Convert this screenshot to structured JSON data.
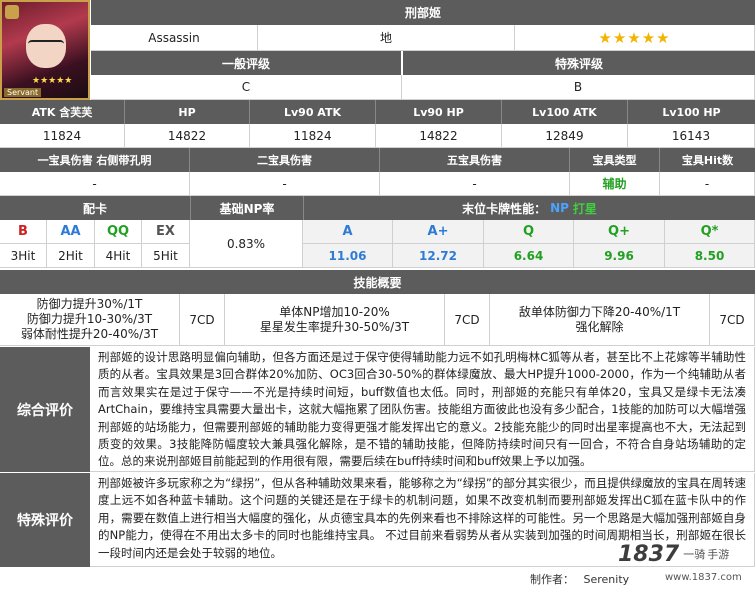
{
  "portrait": {
    "badge": "Servant",
    "rarity_stars": "★★★★★"
  },
  "title": "刑部姬",
  "class_name": "Assassin",
  "attribute": "地",
  "rarity": "★★★★★",
  "rating": {
    "general_label": "一般评级",
    "general_value": "C",
    "special_label": "特殊评级",
    "special_value": "B"
  },
  "stats_headers": [
    "ATK 含芙芙",
    "HP",
    "Lv90 ATK",
    "Lv90 HP",
    "Lv100 ATK",
    "Lv100 HP"
  ],
  "stats_values": [
    "11824",
    "14822",
    "11824",
    "14822",
    "12849",
    "16143"
  ],
  "np_headers": [
    "一宝具伤害 右侧带孔明",
    "二宝具伤害",
    "五宝具伤害",
    "宝具类型",
    "宝具Hit数"
  ],
  "np_values": [
    "-",
    "-",
    "-",
    "辅助",
    "-"
  ],
  "deck": {
    "label": "配卡",
    "cards": [
      {
        "card": "B",
        "hits": "3Hit"
      },
      {
        "card": "AA",
        "hits": "2Hit"
      },
      {
        "card": "QQ",
        "hits": "4Hit"
      },
      {
        "card": "EX",
        "hits": "5Hit"
      }
    ],
    "np_rate_label": "基础NP率",
    "np_rate_value": "0.83%",
    "final_label": "末位卡牌性能：",
    "final_np": "NP",
    "final_star": "打星",
    "final_cards": [
      {
        "card": "A",
        "value": "11.06"
      },
      {
        "card": "A+",
        "value": "12.72"
      },
      {
        "card": "Q",
        "value": "6.64"
      },
      {
        "card": "Q+",
        "value": "9.96"
      },
      {
        "card": "Q*",
        "value": "8.50"
      }
    ]
  },
  "skills": {
    "header": "技能概要",
    "items": [
      {
        "lines": [
          "防御力提升30%/1T",
          "防御力提升10-30%/3T",
          "弱体耐性提升20-40%/3T"
        ],
        "cd": "7CD"
      },
      {
        "lines": [
          "单体NP增加10-20%",
          "星星发生率提升30-50%/3T"
        ],
        "cd": "7CD"
      },
      {
        "lines": [
          "敌单体防御力下降20-40%/1T",
          "强化解除"
        ],
        "cd": "7CD"
      }
    ]
  },
  "overall": {
    "label": "综合评价",
    "text": "刑部姬的设计思路明显偏向辅助，但各方面还是过于保守使得辅助能力远不如孔明梅林C狐等从者，甚至比不上花嫁等半辅助性质的从者。宝具效果是3回合群体20%加防、OC3回合30-50%的群体绿魔放、最大HP提升1000-2000，作为一个纯辅助从者而言效果实在是过于保守——不光是持续时间短，buff数值也太低。同时，刑部姬的充能只有单体20，宝具又是绿卡无法凑ArtChain，要维持宝具需要大量出卡，这就大幅拖累了团队伤害。技能组方面彼此也没有多少配合，1技能的加防可以大幅增强刑部姬的站场能力，但需要刑部姬的辅助能力变得更强才能发挥出它的意义。2技能充能少的同时出星率提高也不大，无法起到质变的效果。3技能降防幅度较大兼具强化解除，是不错的辅助技能，但降防持续时间只有一回合，不符合自身站场辅助的定位。总的来说刑部姬目前能起到的作用很有限，需要后续在buff持续时间和buff效果上予以加强。"
  },
  "special": {
    "label": "特殊评价",
    "text": "刑部姬被许多玩家称之为“绿拐”，但从各种辅助效果来看，能够称之为“绿拐”的部分其实很少，而且提供绿魔放的宝具在周转速度上远不如各种蓝卡辅助。这个问题的关键还是在于绿卡的机制问题，如果不改变机制而要刑部姬发挥出C狐在蓝卡队中的作用，需要在数值上进行相当大幅度的强化，从贞德宝具本的先例来看也不排除这样的可能性。另一个思路是大幅加强刑部姬自身的NP能力，使得在不用出太多卡的同时也能维持宝具。 不过目前来看弱势从者从实装到加强的时间周期相当长，刑部姬在很长一段时间内还是会处于较弱的地位。"
  },
  "footer": {
    "author_label": "制作者：",
    "author": "Serenity",
    "watermark_num": "1837",
    "watermark_a": "一骑",
    "watermark_b": "手游",
    "site": "www.1837.com"
  },
  "colors": {
    "header_bg": "#5c5c5c",
    "star": "#f2b400",
    "buster": "#d02020",
    "arts": "#2e7bd6",
    "quick": "#22a022"
  }
}
